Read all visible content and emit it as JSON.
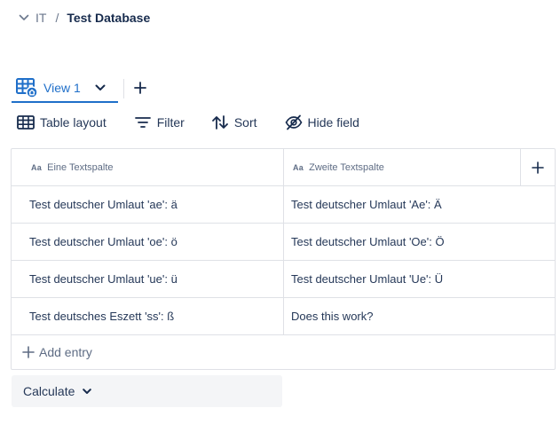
{
  "breadcrumb": {
    "parent": "IT",
    "separator": "/",
    "current": "Test Database"
  },
  "views": {
    "active_view_label": "View 1",
    "accent_color": "#1f6fc9"
  },
  "toolbar": {
    "table_layout": "Table layout",
    "filter": "Filter",
    "sort": "Sort",
    "hide_field": "Hide field"
  },
  "table": {
    "columns": [
      {
        "type_icon": "Aa",
        "label": "Eine Textspalte"
      },
      {
        "type_icon": "Aa",
        "label": "Zweite Textspalte"
      }
    ],
    "rows": [
      [
        "Test deutscher Umlaut 'ae': ä",
        "Test deutscher Umlaut 'Ae': Ä"
      ],
      [
        "Test deutscher Umlaut 'oe': ö",
        "Test deutscher Umlaut 'Oe': Ö"
      ],
      [
        "Test deutscher Umlaut 'ue': ü",
        "Test deutscher Umlaut 'Ue': Ü"
      ],
      [
        "Test deutsches Eszett 'ss': ß",
        "Does this work?"
      ]
    ],
    "add_entry_label": "Add entry"
  },
  "footer": {
    "calculate_label": "Calculate"
  },
  "icons": {
    "breadcrumb_toggle": "chevron-down-icon",
    "view_icon": "table-view-icon",
    "view_dropdown": "chevron-down-icon",
    "add_view": "plus-icon",
    "table_layout": "table-grid-icon",
    "filter": "filter-icon",
    "sort": "sort-arrows-icon",
    "hide_field": "eye-off-icon",
    "add_column": "plus-icon",
    "add_entry": "plus-icon",
    "calculate_dropdown": "chevron-down-icon"
  }
}
